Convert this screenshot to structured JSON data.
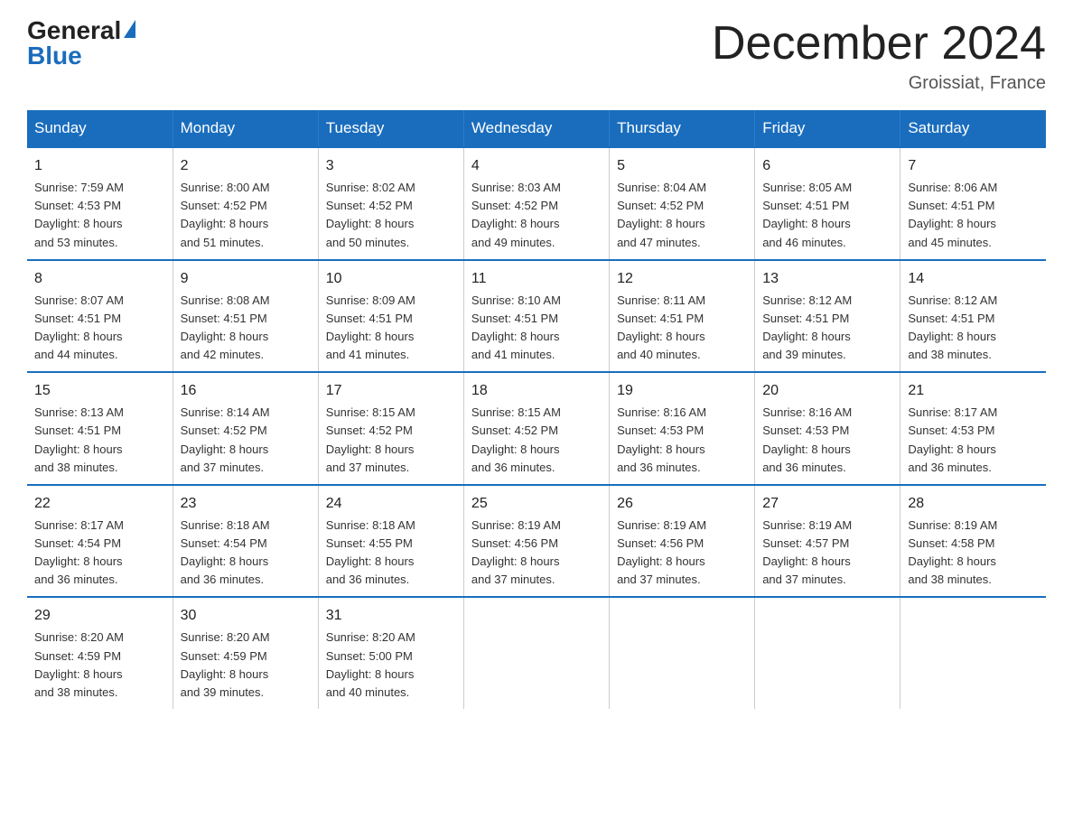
{
  "header": {
    "logo_general": "General",
    "logo_blue": "Blue",
    "month_title": "December 2024",
    "location": "Groissiat, France"
  },
  "days_of_week": [
    "Sunday",
    "Monday",
    "Tuesday",
    "Wednesday",
    "Thursday",
    "Friday",
    "Saturday"
  ],
  "weeks": [
    [
      {
        "day": "1",
        "sunrise": "Sunrise: 7:59 AM",
        "sunset": "Sunset: 4:53 PM",
        "daylight": "Daylight: 8 hours and 53 minutes."
      },
      {
        "day": "2",
        "sunrise": "Sunrise: 8:00 AM",
        "sunset": "Sunset: 4:52 PM",
        "daylight": "Daylight: 8 hours and 51 minutes."
      },
      {
        "day": "3",
        "sunrise": "Sunrise: 8:02 AM",
        "sunset": "Sunset: 4:52 PM",
        "daylight": "Daylight: 8 hours and 50 minutes."
      },
      {
        "day": "4",
        "sunrise": "Sunrise: 8:03 AM",
        "sunset": "Sunset: 4:52 PM",
        "daylight": "Daylight: 8 hours and 49 minutes."
      },
      {
        "day": "5",
        "sunrise": "Sunrise: 8:04 AM",
        "sunset": "Sunset: 4:52 PM",
        "daylight": "Daylight: 8 hours and 47 minutes."
      },
      {
        "day": "6",
        "sunrise": "Sunrise: 8:05 AM",
        "sunset": "Sunset: 4:51 PM",
        "daylight": "Daylight: 8 hours and 46 minutes."
      },
      {
        "day": "7",
        "sunrise": "Sunrise: 8:06 AM",
        "sunset": "Sunset: 4:51 PM",
        "daylight": "Daylight: 8 hours and 45 minutes."
      }
    ],
    [
      {
        "day": "8",
        "sunrise": "Sunrise: 8:07 AM",
        "sunset": "Sunset: 4:51 PM",
        "daylight": "Daylight: 8 hours and 44 minutes."
      },
      {
        "day": "9",
        "sunrise": "Sunrise: 8:08 AM",
        "sunset": "Sunset: 4:51 PM",
        "daylight": "Daylight: 8 hours and 42 minutes."
      },
      {
        "day": "10",
        "sunrise": "Sunrise: 8:09 AM",
        "sunset": "Sunset: 4:51 PM",
        "daylight": "Daylight: 8 hours and 41 minutes."
      },
      {
        "day": "11",
        "sunrise": "Sunrise: 8:10 AM",
        "sunset": "Sunset: 4:51 PM",
        "daylight": "Daylight: 8 hours and 41 minutes."
      },
      {
        "day": "12",
        "sunrise": "Sunrise: 8:11 AM",
        "sunset": "Sunset: 4:51 PM",
        "daylight": "Daylight: 8 hours and 40 minutes."
      },
      {
        "day": "13",
        "sunrise": "Sunrise: 8:12 AM",
        "sunset": "Sunset: 4:51 PM",
        "daylight": "Daylight: 8 hours and 39 minutes."
      },
      {
        "day": "14",
        "sunrise": "Sunrise: 8:12 AM",
        "sunset": "Sunset: 4:51 PM",
        "daylight": "Daylight: 8 hours and 38 minutes."
      }
    ],
    [
      {
        "day": "15",
        "sunrise": "Sunrise: 8:13 AM",
        "sunset": "Sunset: 4:51 PM",
        "daylight": "Daylight: 8 hours and 38 minutes."
      },
      {
        "day": "16",
        "sunrise": "Sunrise: 8:14 AM",
        "sunset": "Sunset: 4:52 PM",
        "daylight": "Daylight: 8 hours and 37 minutes."
      },
      {
        "day": "17",
        "sunrise": "Sunrise: 8:15 AM",
        "sunset": "Sunset: 4:52 PM",
        "daylight": "Daylight: 8 hours and 37 minutes."
      },
      {
        "day": "18",
        "sunrise": "Sunrise: 8:15 AM",
        "sunset": "Sunset: 4:52 PM",
        "daylight": "Daylight: 8 hours and 36 minutes."
      },
      {
        "day": "19",
        "sunrise": "Sunrise: 8:16 AM",
        "sunset": "Sunset: 4:53 PM",
        "daylight": "Daylight: 8 hours and 36 minutes."
      },
      {
        "day": "20",
        "sunrise": "Sunrise: 8:16 AM",
        "sunset": "Sunset: 4:53 PM",
        "daylight": "Daylight: 8 hours and 36 minutes."
      },
      {
        "day": "21",
        "sunrise": "Sunrise: 8:17 AM",
        "sunset": "Sunset: 4:53 PM",
        "daylight": "Daylight: 8 hours and 36 minutes."
      }
    ],
    [
      {
        "day": "22",
        "sunrise": "Sunrise: 8:17 AM",
        "sunset": "Sunset: 4:54 PM",
        "daylight": "Daylight: 8 hours and 36 minutes."
      },
      {
        "day": "23",
        "sunrise": "Sunrise: 8:18 AM",
        "sunset": "Sunset: 4:54 PM",
        "daylight": "Daylight: 8 hours and 36 minutes."
      },
      {
        "day": "24",
        "sunrise": "Sunrise: 8:18 AM",
        "sunset": "Sunset: 4:55 PM",
        "daylight": "Daylight: 8 hours and 36 minutes."
      },
      {
        "day": "25",
        "sunrise": "Sunrise: 8:19 AM",
        "sunset": "Sunset: 4:56 PM",
        "daylight": "Daylight: 8 hours and 37 minutes."
      },
      {
        "day": "26",
        "sunrise": "Sunrise: 8:19 AM",
        "sunset": "Sunset: 4:56 PM",
        "daylight": "Daylight: 8 hours and 37 minutes."
      },
      {
        "day": "27",
        "sunrise": "Sunrise: 8:19 AM",
        "sunset": "Sunset: 4:57 PM",
        "daylight": "Daylight: 8 hours and 37 minutes."
      },
      {
        "day": "28",
        "sunrise": "Sunrise: 8:19 AM",
        "sunset": "Sunset: 4:58 PM",
        "daylight": "Daylight: 8 hours and 38 minutes."
      }
    ],
    [
      {
        "day": "29",
        "sunrise": "Sunrise: 8:20 AM",
        "sunset": "Sunset: 4:59 PM",
        "daylight": "Daylight: 8 hours and 38 minutes."
      },
      {
        "day": "30",
        "sunrise": "Sunrise: 8:20 AM",
        "sunset": "Sunset: 4:59 PM",
        "daylight": "Daylight: 8 hours and 39 minutes."
      },
      {
        "day": "31",
        "sunrise": "Sunrise: 8:20 AM",
        "sunset": "Sunset: 5:00 PM",
        "daylight": "Daylight: 8 hours and 40 minutes."
      },
      null,
      null,
      null,
      null
    ]
  ]
}
